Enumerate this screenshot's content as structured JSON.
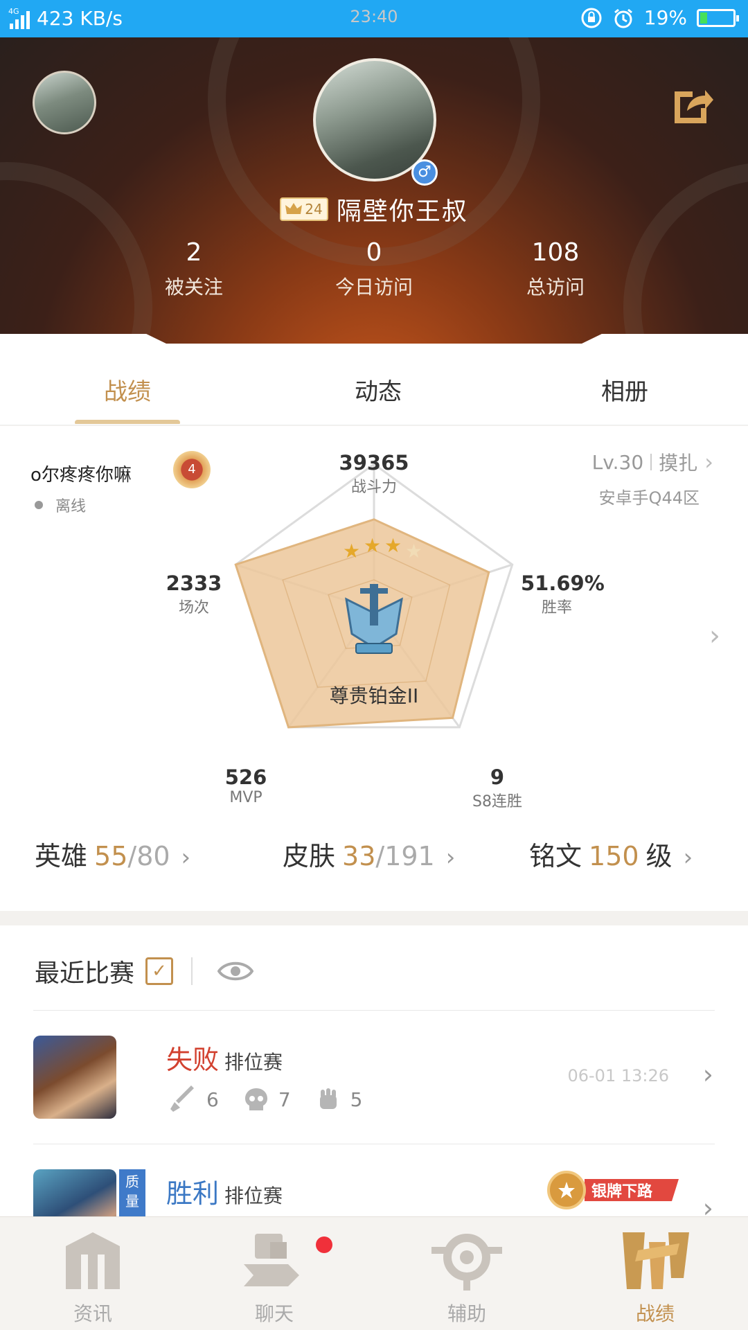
{
  "status_bar": {
    "network": "4G",
    "speed": "423 KB/s",
    "time": "23:40",
    "battery": "19%"
  },
  "profile": {
    "vip_level": "24",
    "username": "隔壁你王叔",
    "stats": [
      {
        "value": "2",
        "label": "被关注"
      },
      {
        "value": "0",
        "label": "今日访问"
      },
      {
        "value": "108",
        "label": "总访问"
      }
    ]
  },
  "tabs": [
    {
      "label": "战绩"
    },
    {
      "label": "动态"
    },
    {
      "label": "相册"
    }
  ],
  "battle": {
    "game_name": "o尔疼疼你嘛",
    "rank_badge": "4",
    "status": "离线",
    "level": "Lv.30",
    "role": "摸扎",
    "server": "安卓手Q44区",
    "rank_name": "尊贵铂金II",
    "rank_stars": 3,
    "rank_stars_total": 4,
    "radar": [
      {
        "value": "39365",
        "label": "战斗力"
      },
      {
        "value": "51.69%",
        "label": "胜率"
      },
      {
        "value": "9",
        "label": "S8连胜"
      },
      {
        "value": "526",
        "label": "MVP"
      },
      {
        "value": "2333",
        "label": "场次"
      }
    ],
    "radar_fill": [
      0.62,
      0.83,
      0.92,
      1.0,
      1.0
    ],
    "counts": {
      "heroes": {
        "label": "英雄",
        "current": "55",
        "total": "80"
      },
      "skins": {
        "label": "皮肤",
        "current": "33",
        "total": "191"
      },
      "inscriptions": {
        "label": "铭文",
        "value": "150",
        "unit": "级"
      }
    }
  },
  "recent": {
    "title": "最近比赛",
    "matches": [
      {
        "result": "失败",
        "result_color": "#d2412f",
        "mode": "排位赛",
        "kills": "6",
        "deaths": "7",
        "assists": "5",
        "time": "06-01 13:26"
      },
      {
        "result": "胜利",
        "result_color": "#3b78c4",
        "mode": "排位赛",
        "quality_tag": "质量",
        "medal": "银牌下路"
      }
    ]
  },
  "bottom_nav": [
    {
      "label": "资讯"
    },
    {
      "label": "聊天"
    },
    {
      "label": "辅助"
    },
    {
      "label": "战绩"
    }
  ],
  "colors": {
    "accent": "#c2904e",
    "status_bar": "#21a8f3",
    "loss": "#d2412f",
    "win": "#3b78c4"
  }
}
